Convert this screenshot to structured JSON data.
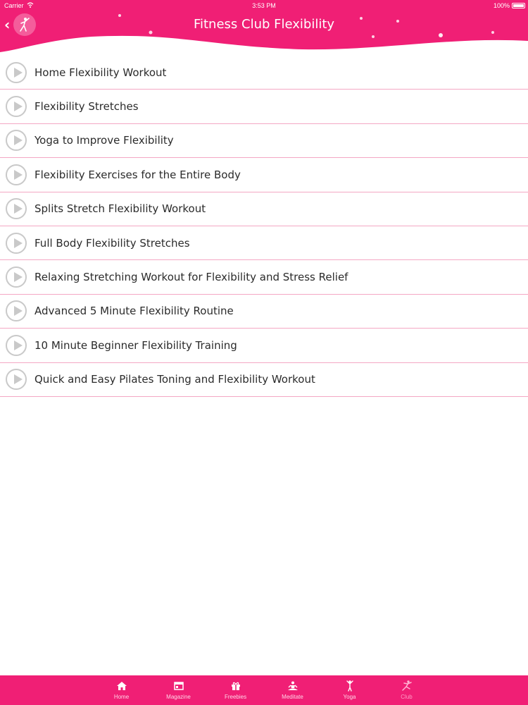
{
  "status_bar": {
    "carrier": "Carrier",
    "time": "3:53 PM",
    "battery": "100%"
  },
  "header": {
    "title": "Fitness Club Flexibility",
    "back_icon": "chevron-left-icon",
    "avatar_icon": "gymnast-icon",
    "colors": {
      "brand": "#f01f75",
      "list_divider": "#f4a8c4",
      "play_icon": "#c9c9c9"
    }
  },
  "list": {
    "items": [
      {
        "label": "Home Flexibility Workout"
      },
      {
        "label": "Flexibility Stretches"
      },
      {
        "label": "Yoga to Improve Flexibility"
      },
      {
        "label": "Flexibility Exercises for the Entire Body"
      },
      {
        "label": "Splits Stretch Flexibility Workout"
      },
      {
        "label": "Full Body Flexibility Stretches"
      },
      {
        "label": "Relaxing Stretching Workout for Flexibility and Stress Relief"
      },
      {
        "label": "Advanced 5 Minute Flexibility Routine"
      },
      {
        "label": "10 Minute Beginner Flexibility Training"
      },
      {
        "label": "Quick and Easy Pilates Toning and Flexibility Workout"
      }
    ]
  },
  "tabbar": {
    "tabs": [
      {
        "label": "Home",
        "icon": "home-icon"
      },
      {
        "label": "Magazine",
        "icon": "magazine-icon"
      },
      {
        "label": "Freebies",
        "icon": "gift-icon"
      },
      {
        "label": "Meditate",
        "icon": "meditate-icon"
      },
      {
        "label": "Yoga",
        "icon": "yoga-icon"
      },
      {
        "label": "Club",
        "icon": "club-icon"
      }
    ],
    "active": "Club"
  }
}
